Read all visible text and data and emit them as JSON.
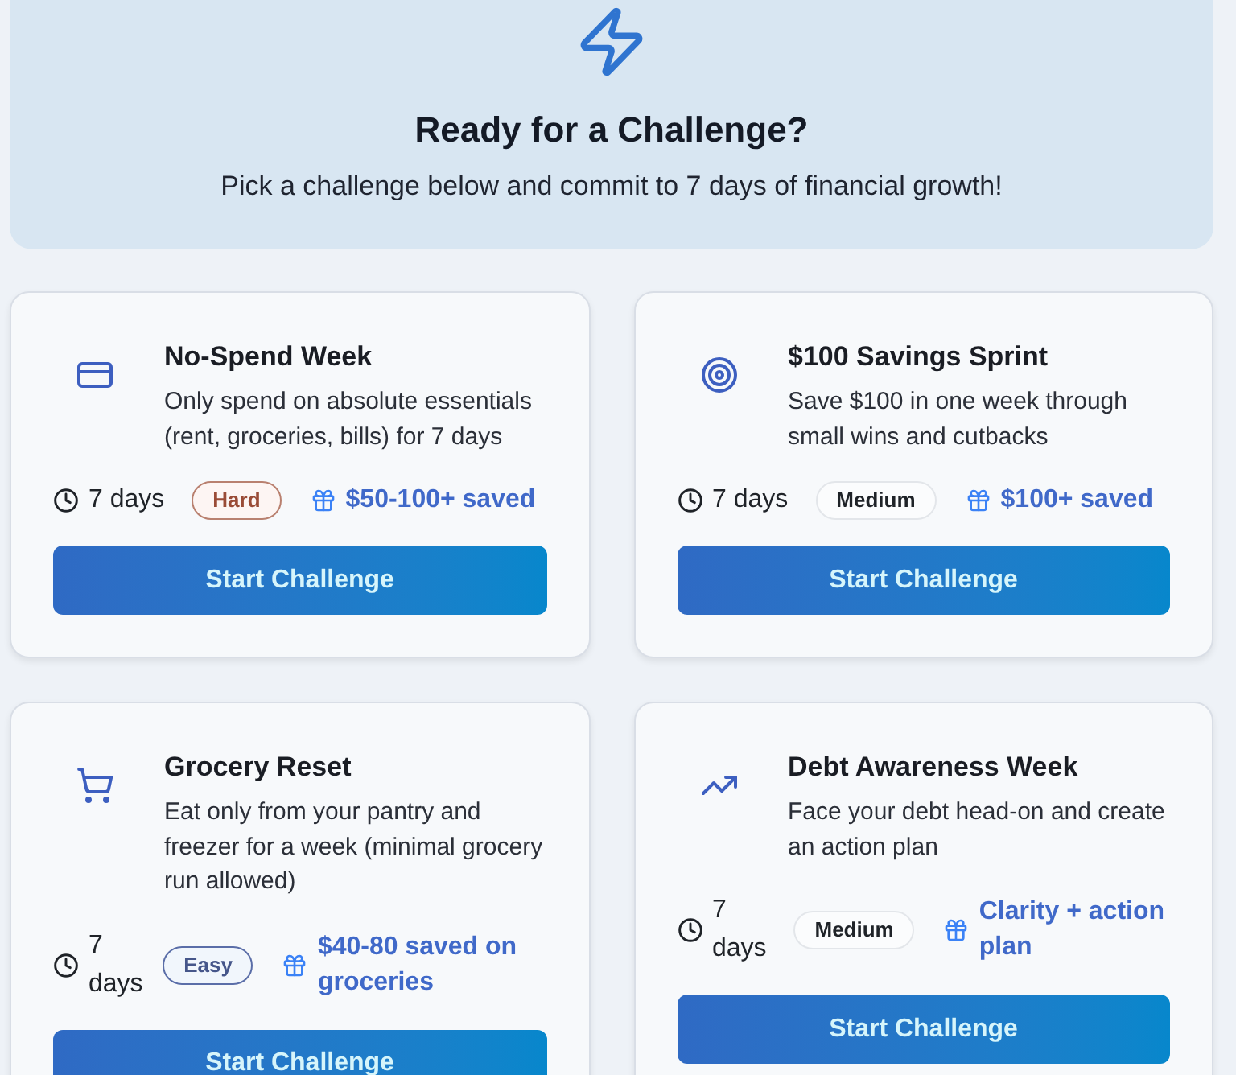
{
  "hero": {
    "title": "Ready for a Challenge?",
    "subtitle": "Pick a challenge below and commit to 7 days of financial growth!"
  },
  "challenges": [
    {
      "kind": "card",
      "title": "No-Spend Week",
      "description": "Only spend on absolute essentials (rent, groceries, bills) for 7 days",
      "duration": "7 days",
      "difficulty": {
        "label": "Hard",
        "kind": "hard"
      },
      "reward": "$50-100+ saved",
      "button": "Start Challenge"
    },
    {
      "kind": "target",
      "title": "$100 Savings Sprint",
      "description": "Save $100 in one week through small wins and cutbacks",
      "duration": "7 days",
      "difficulty": {
        "label": "Medium",
        "kind": "medium"
      },
      "reward": "$100+ saved",
      "button": "Start Challenge"
    },
    {
      "kind": "cart",
      "title": "Grocery Reset",
      "description": "Eat only from your pantry and freezer for a week (minimal grocery run allowed)",
      "duration": "7 days",
      "difficulty": {
        "label": "Easy",
        "kind": "easy"
      },
      "reward": "$40-80 saved on groceries",
      "button": "Start Challenge"
    },
    {
      "kind": "trend",
      "title": "Debt Awareness Week",
      "description": "Face your debt head-on and create an action plan",
      "duration": "7 days",
      "difficulty": {
        "label": "Medium",
        "kind": "medium"
      },
      "reward": "Clarity + action plan",
      "button": "Start Challenge"
    }
  ]
}
